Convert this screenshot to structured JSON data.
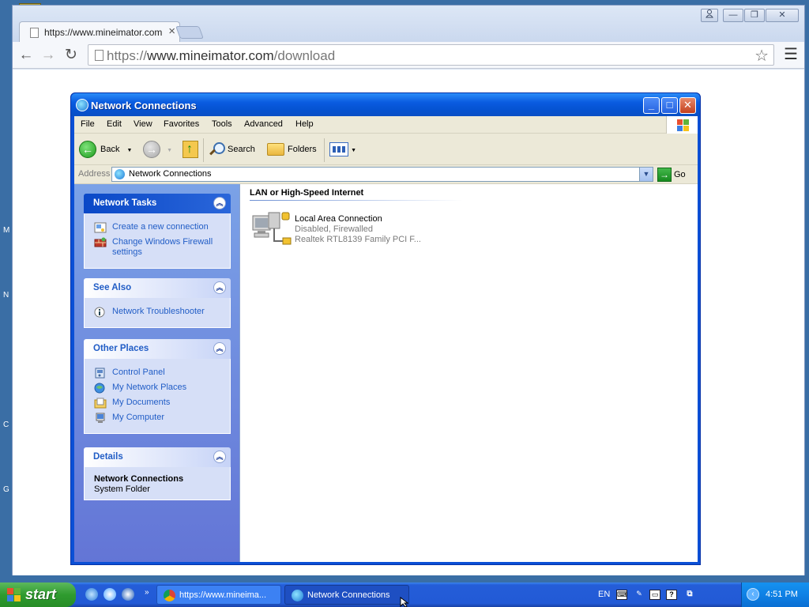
{
  "desktop": {
    "edge_letters": [
      "M",
      "N",
      "C",
      "G"
    ]
  },
  "browser": {
    "tab_title": "https://www.mineimator.com",
    "url_scheme": "https://",
    "url_host": "www.mineimator.com",
    "url_path": "/download",
    "icons": {
      "back": "arrow-left-icon",
      "forward": "arrow-right-icon",
      "reload": "reload-icon",
      "bookmark": "star-icon",
      "menu": "hamburger-menu-icon"
    }
  },
  "explorer": {
    "title": "Network Connections",
    "menu": [
      "File",
      "Edit",
      "View",
      "Favorites",
      "Tools",
      "Advanced",
      "Help"
    ],
    "toolbar": {
      "back": "Back",
      "search": "Search",
      "folders": "Folders"
    },
    "address": {
      "label": "Address",
      "value": "Network Connections",
      "go": "Go"
    },
    "panels": {
      "network_tasks": {
        "title": "Network Tasks",
        "items": [
          "Create a new connection",
          "Change Windows Firewall settings"
        ]
      },
      "see_also": {
        "title": "See Also",
        "items": [
          "Network Troubleshooter"
        ]
      },
      "other_places": {
        "title": "Other Places",
        "items": [
          "Control Panel",
          "My Network Places",
          "My Documents",
          "My Computer"
        ]
      },
      "details": {
        "title": "Details",
        "name": "Network Connections",
        "type": "System Folder"
      }
    },
    "group_header": "LAN or High-Speed Internet",
    "connection": {
      "name": "Local Area Connection",
      "status": "Disabled, Firewalled",
      "device": "Realtek RTL8139 Family PCI F..."
    }
  },
  "taskbar": {
    "start_label": "start",
    "tasks": [
      "https://www.mineima...",
      "Network Connections"
    ],
    "language": "EN",
    "clock": "4:51 PM"
  },
  "colors": {
    "xp_title_blue": "#0a5be0",
    "taskbar_blue": "#245dd8",
    "start_green": "#2f9b2f",
    "link_blue": "#215dc6"
  }
}
